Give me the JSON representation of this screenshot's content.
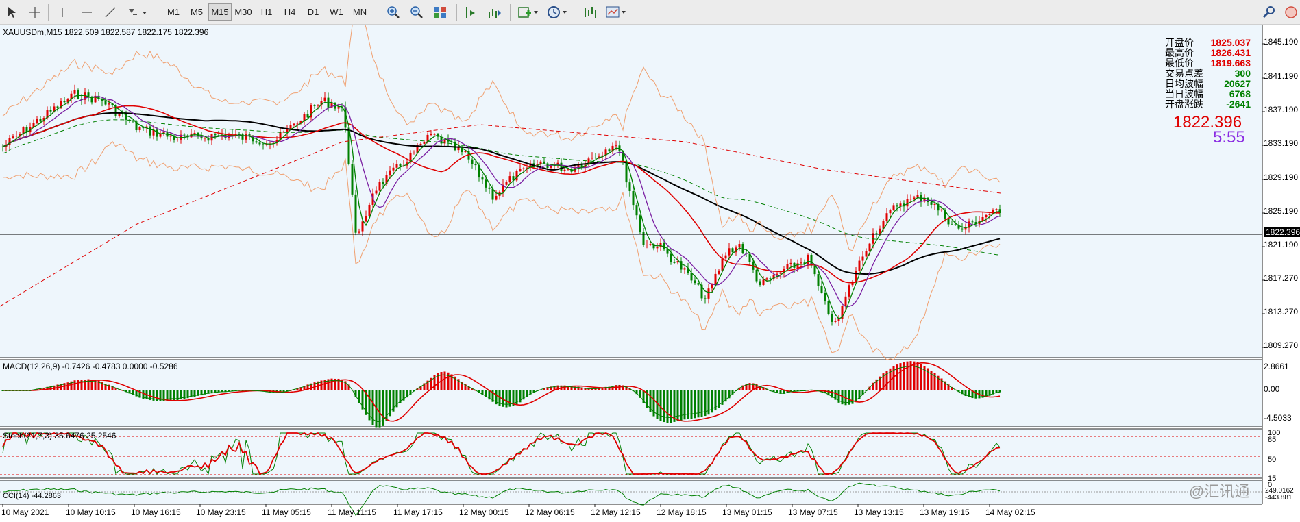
{
  "toolbar": {
    "timeframes": [
      "M1",
      "M5",
      "M15",
      "M30",
      "H1",
      "H4",
      "D1",
      "W1",
      "MN"
    ],
    "active_timeframe": "M15"
  },
  "chart": {
    "header": "XAUUSDm,M15  1822.509 1822.587 1822.175 1822.396",
    "price_axis": [
      "1845.190",
      "1841.190",
      "1837.190",
      "1833.190",
      "1829.190",
      "1825.190",
      "1821.190",
      "1817.270",
      "1813.270",
      "1809.270"
    ],
    "current_price_tag": "1822.396",
    "stats": [
      {
        "label": "开盘价",
        "value": "1825.037",
        "color": "#e00000"
      },
      {
        "label": "最高价",
        "value": "1826.431",
        "color": "#e00000"
      },
      {
        "label": "最低价",
        "value": "1819.663",
        "color": "#e00000"
      },
      {
        "label": "交易点差",
        "value": "300",
        "color": "#008000"
      },
      {
        "label": "日均波幅",
        "value": "20627",
        "color": "#008000"
      },
      {
        "label": "当日波幅",
        "value": "6768",
        "color": "#008000"
      },
      {
        "label": "开盘涨跌",
        "value": "-2641",
        "color": "#008000"
      }
    ],
    "big_price": "1822.396",
    "countdown": "5:55",
    "time_axis": [
      "10 May 2021",
      "10 May 10:15",
      "10 May 16:15",
      "10 May 23:15",
      "11 May 05:15",
      "11 May 11:15",
      "11 May 17:15",
      "12 May 00:15",
      "12 May 06:15",
      "12 May 12:15",
      "12 May 18:15",
      "13 May 01:15",
      "13 May 07:15",
      "13 May 13:15",
      "13 May 19:15",
      "14 May 02:15"
    ]
  },
  "macd": {
    "header": "MACD(12,26,9) -0.7426 -0.4783 0.0000 -0.5286",
    "axis": [
      "2.8661",
      "0.00",
      "-4.5033"
    ]
  },
  "stoch": {
    "header": "Stoch(21,7,3) 35.6476 25.2546",
    "axis": [
      "100",
      "85",
      "50",
      "15",
      "0"
    ]
  },
  "cci": {
    "header": "CCI(14) -44.2863",
    "axis_top": "249.0162",
    "axis_bottom": "-443.881"
  },
  "watermark": "@汇讯通",
  "colors": {
    "bull": "#e00000",
    "bear": "#008000",
    "background": "#eef6fc"
  }
}
